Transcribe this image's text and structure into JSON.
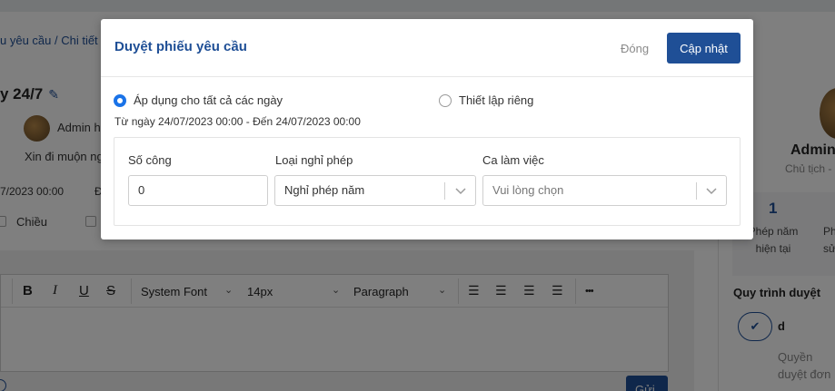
{
  "background": {
    "breadcrumb": "u yêu cầu / Chi tiết p",
    "page_title": "y 24/7",
    "requester": "Admin h",
    "reason": "Xin đi muộn ng",
    "date_fragment": "7/2023 00:00",
    "date_letter": "Đ",
    "shift_option": "Chiều",
    "editor": {
      "bold": "B",
      "italic": "I",
      "underline": "U",
      "strike": "S",
      "font_family": "System Font",
      "font_size": "14px",
      "block_format": "Paragraph",
      "more": "•••"
    },
    "send_button": "Gửi",
    "profile": {
      "name": "Admin",
      "role": "Chủ tịch -",
      "leave_count": "1",
      "leave_label": "Phép năm hiện tại",
      "leave_label2": "Ph sử",
      "workflow_title": "Quy trình duyệt",
      "step_name": "d",
      "step_desc": "Quyền duyệt đơn"
    }
  },
  "modal": {
    "title": "Duyệt phiếu yêu cầu",
    "close_label": "Đóng",
    "update_label": "Cập nhật",
    "option_all_days": "Áp dụng cho tất cả các ngày",
    "option_custom": "Thiết lập riêng",
    "date_range": "Từ ngày 24/07/2023 00:00 - Đến 24/07/2023 00:00",
    "fields": {
      "workdays_label": "Số công",
      "workdays_value": "0",
      "leave_type_label": "Loại nghỉ phép",
      "leave_type_value": "Nghỉ phép năm",
      "shift_label": "Ca làm việc",
      "shift_placeholder": "Vui lòng chọn"
    }
  },
  "colors": {
    "primary": "#1f4f96",
    "radio_checked": "#1a73e8",
    "overlay": "rgba(0,0,0,0.5)"
  }
}
